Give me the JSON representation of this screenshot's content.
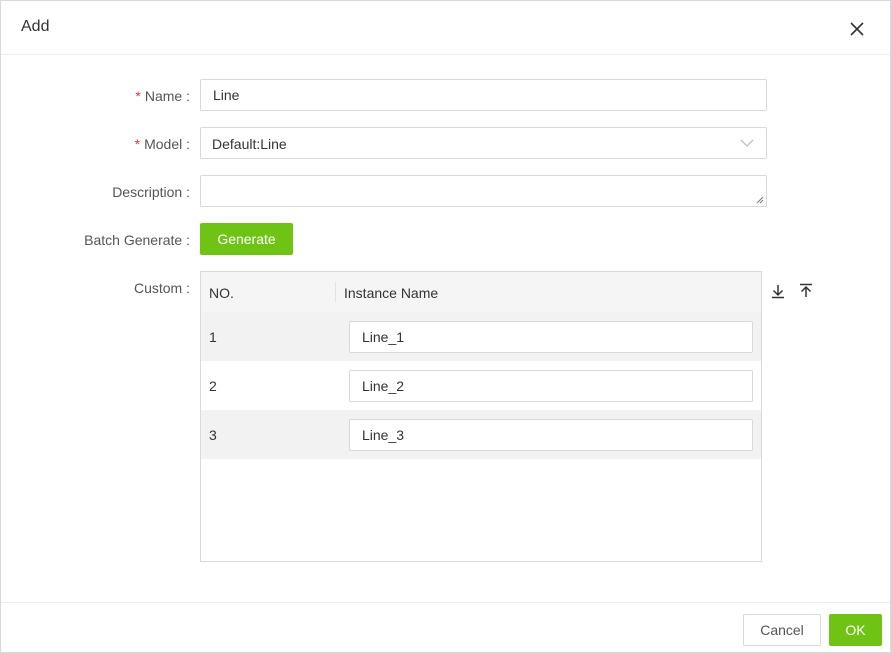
{
  "dialog": {
    "title": "Add",
    "close_icon": "close-icon"
  },
  "form": {
    "name": {
      "label": "Name :",
      "required": "*",
      "value": "Line"
    },
    "model": {
      "label": "Model :",
      "required": "*",
      "value": "Default:Line"
    },
    "description": {
      "label": "Description :",
      "value": ""
    },
    "batch": {
      "label": "Batch Generate :",
      "button": "Generate"
    },
    "custom": {
      "label": "Custom :",
      "columns": [
        "NO.",
        "Instance Name"
      ],
      "rows": [
        {
          "no": "1",
          "name": "Line_1"
        },
        {
          "no": "2",
          "name": "Line_2"
        },
        {
          "no": "3",
          "name": "Line_3"
        }
      ],
      "icons": [
        "download-icon",
        "upload-icon"
      ]
    }
  },
  "footer": {
    "cancel": "Cancel",
    "ok": "OK"
  },
  "colors": {
    "accent": "#6fc314",
    "required": "#ee3333",
    "alt_row": "#f2f2f2"
  }
}
